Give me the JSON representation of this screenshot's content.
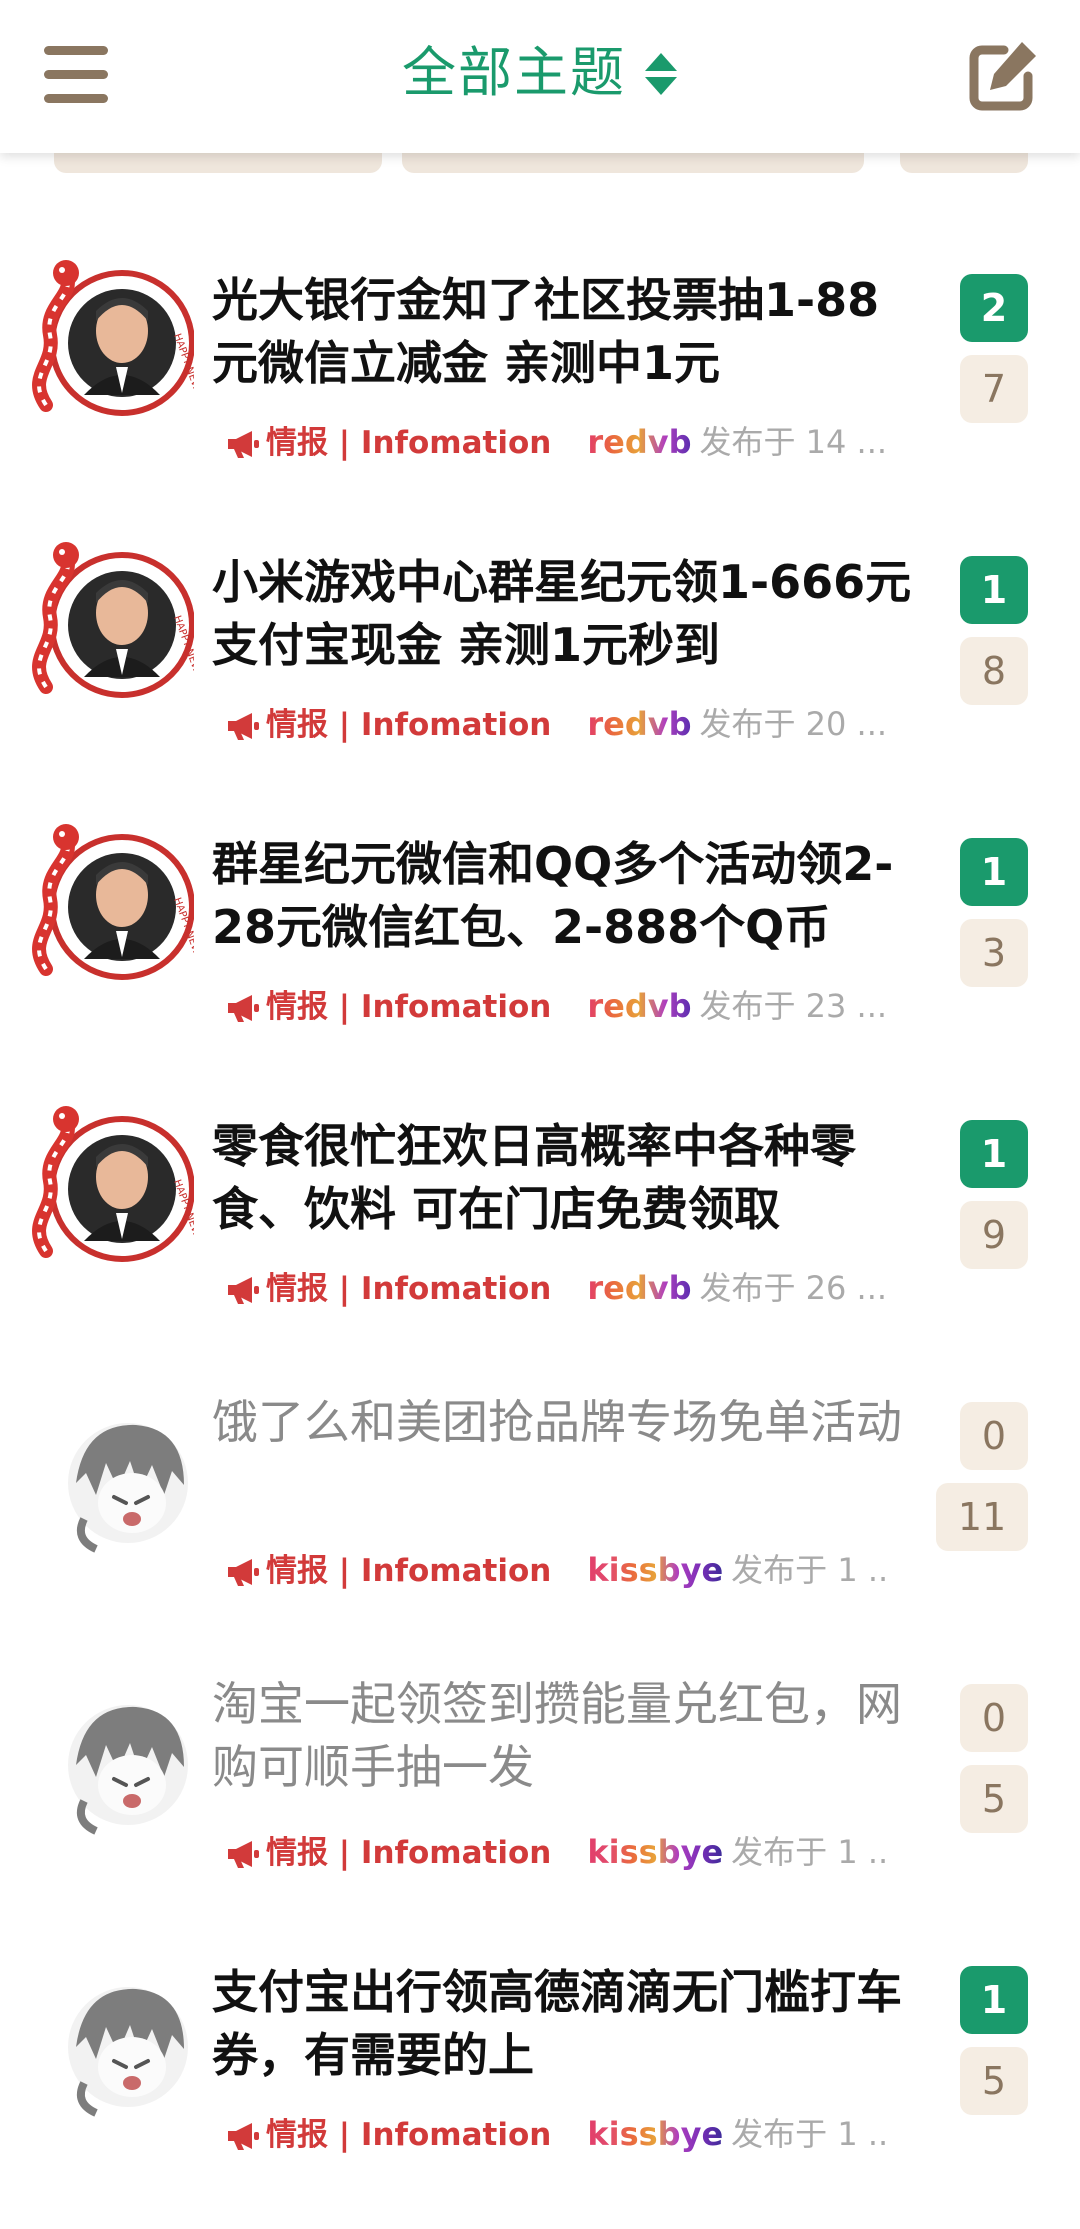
{
  "header": {
    "title": "全部主题"
  },
  "topics": [
    {
      "title": "光大银行金知了社区投票抽1-88元微信立减金 亲测中1元",
      "category": "情报 | Infomation",
      "author": "redvb",
      "posted": "发布于 14 ...",
      "replies": "2",
      "views": "7",
      "read": false,
      "avatar": "elon"
    },
    {
      "title": "小米游戏中心群星纪元领1-666元支付宝现金 亲测1元秒到",
      "category": "情报 | Infomation",
      "author": "redvb",
      "posted": "发布于 20 ...",
      "replies": "1",
      "views": "8",
      "read": false,
      "avatar": "elon"
    },
    {
      "title": "群星纪元微信和QQ多个活动领2-28元微信红包、2-888个Q币",
      "category": "情报 | Infomation",
      "author": "redvb",
      "posted": "发布于 23 ...",
      "replies": "1",
      "views": "3",
      "read": false,
      "avatar": "elon"
    },
    {
      "title": "零食很忙狂欢日高概率中各种零食、饮料 可在门店免费领取",
      "category": "情报 | Infomation",
      "author": "redvb",
      "posted": "发布于 26 ...",
      "replies": "1",
      "views": "9",
      "read": false,
      "avatar": "elon"
    },
    {
      "title": "饿了么和美团抢品牌专场免单活动",
      "category": "情报 | Infomation",
      "author": "kissbye",
      "posted": "发布于 1 ...",
      "replies": "0",
      "views": "11",
      "read": true,
      "avatar": "anime"
    },
    {
      "title": "淘宝一起领签到攒能量兑红包，网购可顺手抽一发",
      "category": "情报 | Infomation",
      "author": "kissbye",
      "posted": "发布于 1 ...",
      "replies": "0",
      "views": "5",
      "read": true,
      "avatar": "anime"
    },
    {
      "title": "支付宝出行领高德滴滴无门槛打车券，有需要的上",
      "category": "情报 | Infomation",
      "author": "kissbye",
      "posted": "发布于 1 ...",
      "replies": "1",
      "views": "5",
      "read": false,
      "avatar": "anime"
    }
  ],
  "colors": {
    "accent": "#1a9a6c",
    "brown": "#8a7660",
    "category": "#d23a3a",
    "badge_beige": "#f5ede3"
  }
}
